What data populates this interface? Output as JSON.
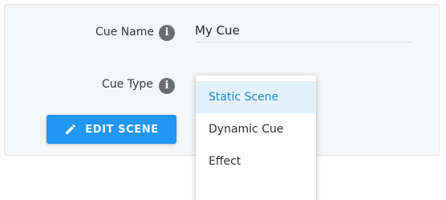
{
  "form": {
    "cue_name_label": "Cue Name",
    "cue_name_value": "My Cue",
    "cue_type_label": "Cue Type",
    "info_icon_glyph": "i"
  },
  "actions": {
    "edit_scene_label": "EDIT SCENE",
    "edit_scene_icon": "pencil-icon"
  },
  "cue_type_menu": {
    "selected_index": 0,
    "options": [
      "Static Scene",
      "Dynamic Cue",
      "Effect"
    ]
  },
  "colors": {
    "accent": "#2196f3",
    "selected_text": "#1e8bd1",
    "selected_bg": "#e3f1fb",
    "panel_bg": "#f5f6f8"
  }
}
